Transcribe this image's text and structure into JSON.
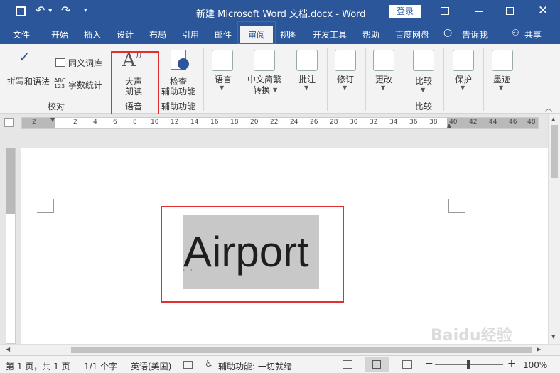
{
  "titlebar": {
    "document_title": "新建 Microsoft Word 文档.docx - Word",
    "login_label": "登录"
  },
  "tabs": [
    "文件",
    "开始",
    "插入",
    "设计",
    "布局",
    "引用",
    "邮件",
    "审阅",
    "视图",
    "开发工具",
    "帮助",
    "百度网盘"
  ],
  "tell_me": "告诉我",
  "share_label": "共享",
  "ribbon": {
    "spelling_grammar": "拼写和语法",
    "thesaurus": "同义词库",
    "word_count": "字数统计",
    "group_proofing": "校对",
    "read_aloud_line1": "大声",
    "read_aloud_line2": "朗读",
    "group_speech": "语音",
    "check_accessibility_line1": "检查",
    "check_accessibility_line2": "辅助功能",
    "group_accessibility": "辅助功能",
    "language": "语言",
    "chinese_conversion_line1": "中文简繁",
    "chinese_conversion_line2": "转换",
    "comments": "批注",
    "tracking": "修订",
    "changes": "更改",
    "compare": "比较",
    "group_compare": "比较",
    "protect": "保护",
    "ink": "墨迹"
  },
  "ruler_numbers": [
    "2",
    "2",
    "4",
    "6",
    "8",
    "10",
    "12",
    "14",
    "16",
    "18",
    "20",
    "22",
    "24",
    "26",
    "28",
    "30",
    "32",
    "34",
    "36",
    "38",
    "40",
    "42",
    "44",
    "46",
    "48"
  ],
  "document": {
    "text": "Airport"
  },
  "statusbar": {
    "page": "第 1 页，共 1 页",
    "words": "1/1 个字",
    "language": "英语(美国)",
    "accessibility": "辅助功能: 一切就绪",
    "zoom": "100%",
    "zoom_level": 1.0
  },
  "watermark": "Baidu经验",
  "colors": {
    "accent": "#2b579a",
    "highlight_box": "#e0302f",
    "selection": "#c8c8c8"
  }
}
